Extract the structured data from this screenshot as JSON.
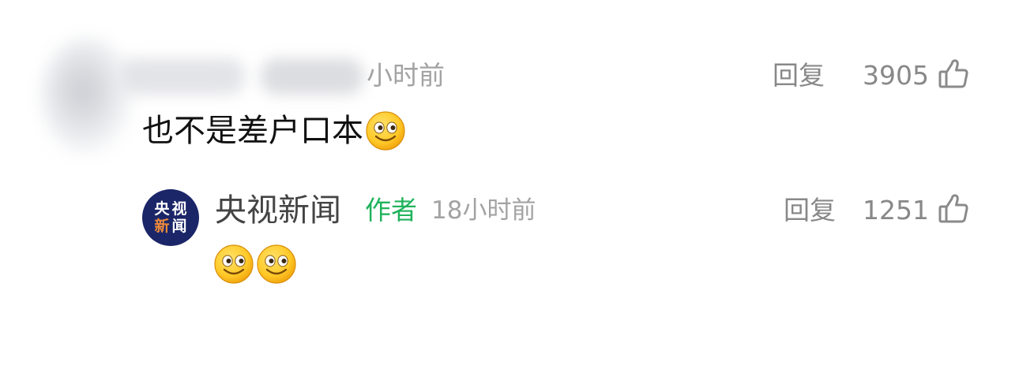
{
  "comment": {
    "time_suffix": "小时前",
    "text": "也不是差户口本",
    "emoji": "smile-emoji",
    "reply_label": "回复",
    "like_count": "3905",
    "like_icon": "thumbs-up-icon"
  },
  "reply": {
    "avatar_chars": [
      "央",
      "视",
      "新",
      "闻"
    ],
    "author": "央视新闻",
    "badge": "作者",
    "time": "18小时前",
    "emojis": [
      "smile-emoji",
      "smile-emoji"
    ],
    "reply_label": "回复",
    "like_count": "1251",
    "like_icon": "thumbs-up-icon"
  },
  "colors": {
    "badge_green": "#20b35c",
    "avatar_navy": "#1b2668",
    "avatar_accent": "#ee8a3a",
    "muted_gray": "#a3a3a3"
  }
}
